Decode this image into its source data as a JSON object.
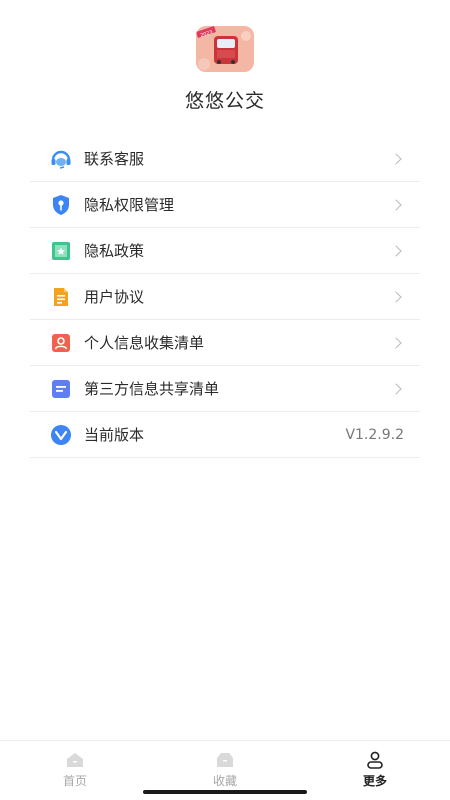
{
  "app": {
    "name": "悠悠公交",
    "logo_badge": "2023"
  },
  "menu": {
    "items": [
      {
        "label": "联系客服",
        "icon": "headset-icon",
        "color": "#3b8ff0"
      },
      {
        "label": "隐私权限管理",
        "icon": "shield-key-icon",
        "color": "#3d84f5"
      },
      {
        "label": "隐私政策",
        "icon": "bookmark-star-icon",
        "color": "#3dc58d"
      },
      {
        "label": "用户协议",
        "icon": "document-icon",
        "color": "#f5a21f"
      },
      {
        "label": "个人信息收集清单",
        "icon": "person-card-icon",
        "color": "#f0624f"
      },
      {
        "label": "第三方信息共享清单",
        "icon": "list-card-icon",
        "color": "#5f7ff0"
      },
      {
        "label": "当前版本",
        "icon": "version-icon",
        "color": "#3d84f5",
        "value": "V1.2.9.2"
      }
    ]
  },
  "tabbar": {
    "tabs": [
      {
        "label": "首页",
        "icon": "home-icon",
        "active": false
      },
      {
        "label": "收藏",
        "icon": "favorites-icon",
        "active": false
      },
      {
        "label": "更多",
        "icon": "profile-icon",
        "active": true
      }
    ]
  }
}
